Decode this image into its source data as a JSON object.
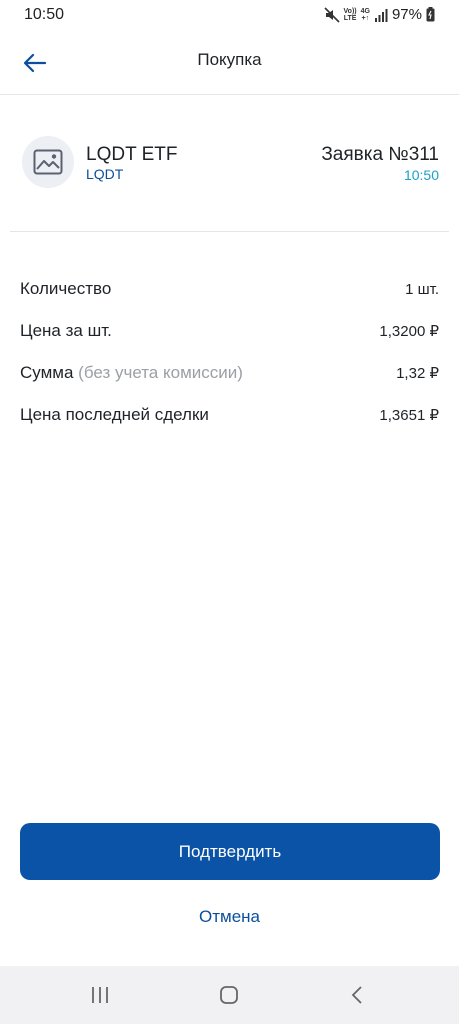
{
  "status_bar": {
    "time": "10:50",
    "volte_top": "Vo))",
    "volte_bottom": "LTE",
    "net_top": "4G",
    "net_bottom": "+↑",
    "battery": "97%"
  },
  "header": {
    "title": "Покупка"
  },
  "instrument": {
    "name": "LQDT ETF",
    "ticker": "LQDT",
    "order_number": "Заявка №311",
    "order_time": "10:50"
  },
  "details": [
    {
      "label": "Количество",
      "note": "",
      "value": "1 шт."
    },
    {
      "label": "Цена за шт.",
      "note": "",
      "value": "1,3200 ₽"
    },
    {
      "label": "Сумма",
      "note": "(без учета комиссии)",
      "value": "1,32 ₽"
    },
    {
      "label": "Цена последней сделки",
      "note": "",
      "value": "1,3651 ₽"
    }
  ],
  "actions": {
    "confirm_label": "Подтвердить",
    "cancel_label": "Отмена"
  },
  "colors": {
    "accent": "#0b53a6",
    "link": "#0b4f9c",
    "time_accent": "#1aa0c8"
  }
}
